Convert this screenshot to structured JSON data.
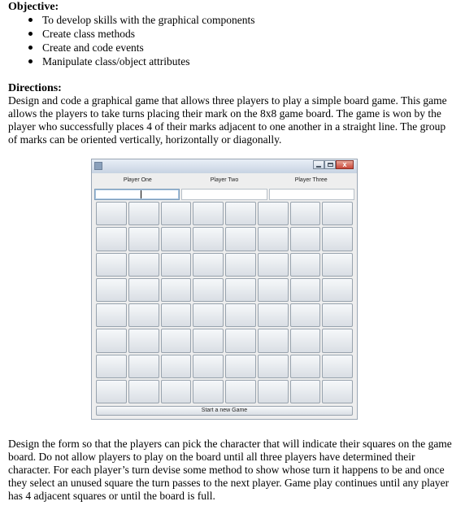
{
  "objective": {
    "heading": "Objective:",
    "items": [
      "To develop skills with the graphical components",
      "Create class methods",
      "Create and code events",
      "Manipulate class/object attributes"
    ]
  },
  "directions": {
    "heading": "Directions:",
    "text": "Design and code a graphical game that allows three players to play a simple board game. This game allows the players to take turns placing their mark on the 8x8 game board. The game is won by the player who successfully places 4 of their marks adjacent to one another in a straight line. The group of marks can be oriented vertically, horizontally or diagonally."
  },
  "game_window": {
    "player_labels": [
      "Player One",
      "Player Two",
      "Player Three"
    ],
    "player_fields": [
      "",
      "",
      ""
    ],
    "board_size": 8,
    "new_game_label": "Start a new Game",
    "close_glyph": "x"
  },
  "design": {
    "text": "Design the form so that the players can pick the character that will indicate their squares on the game board. Do not allow players to play on the board until all three players have determined their character. For each player’s turn devise some method to show whose turn it happens to be and once they select an unused square the turn passes to the next player. Game play continues until any player has 4 adjacent squares or until the board is full."
  }
}
